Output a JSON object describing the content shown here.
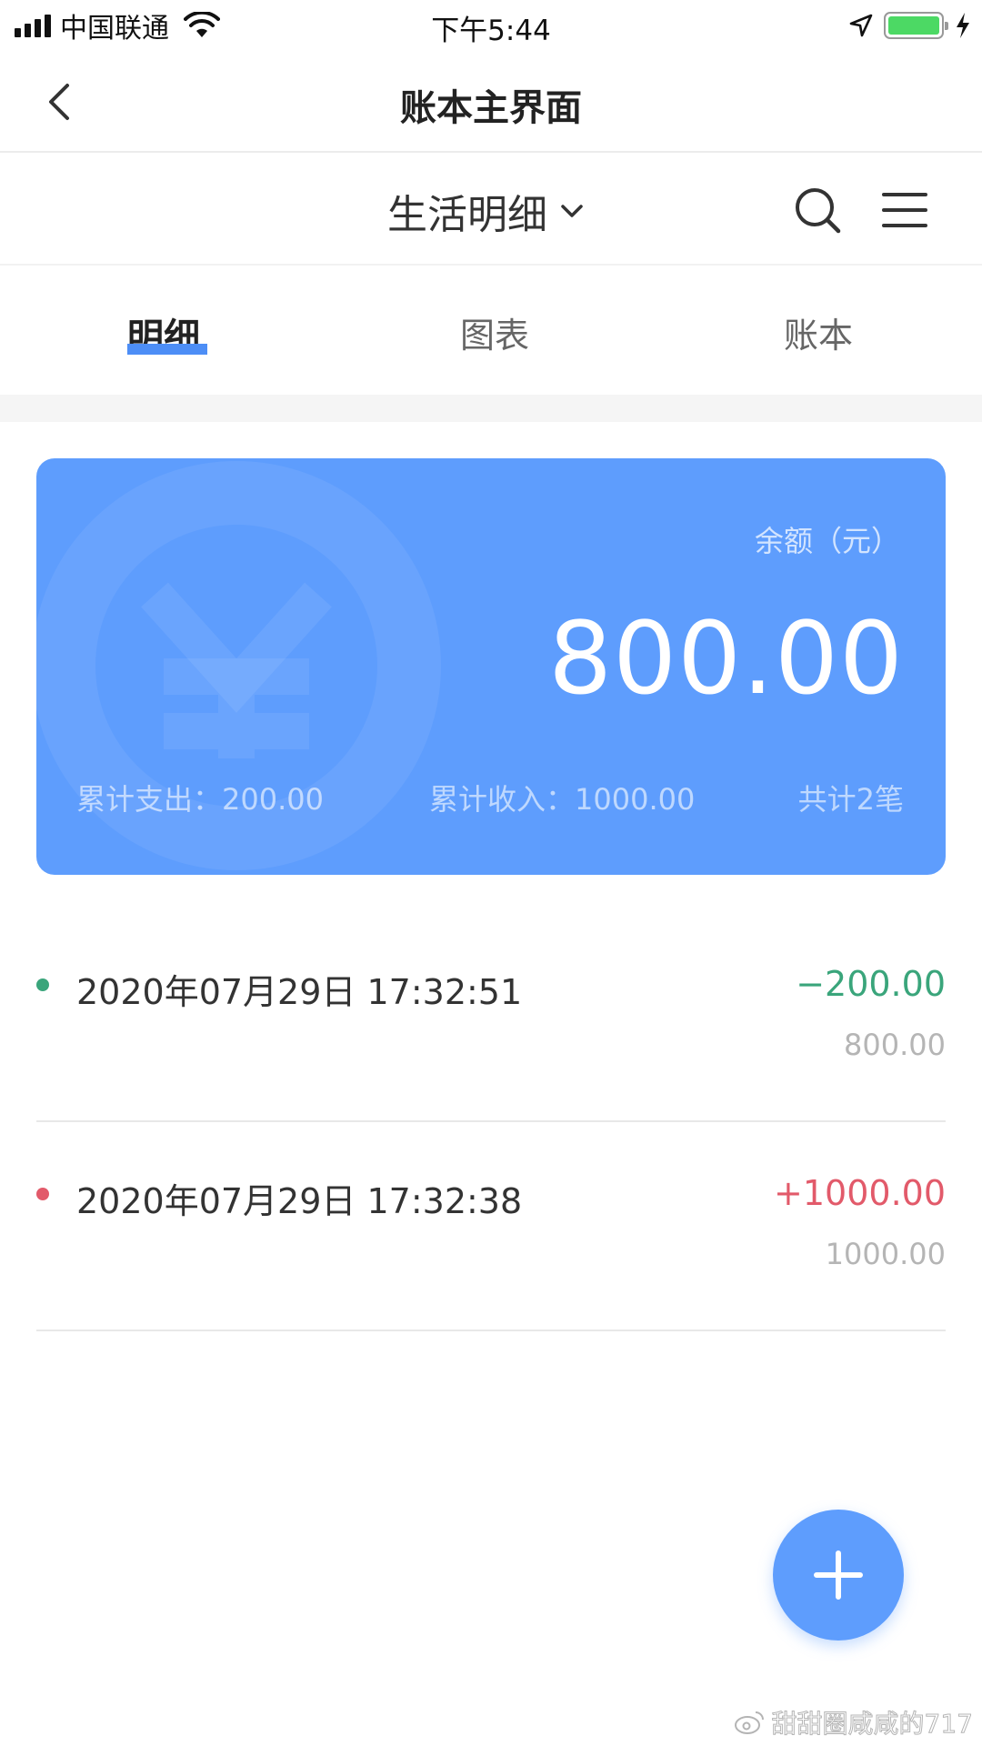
{
  "status_bar": {
    "carrier": "中国联通",
    "time": "下午5:44",
    "battery_level": 1.0,
    "battery_color": "#4cd964"
  },
  "nav": {
    "title": "账本主界面",
    "back_icon": "chevron-left-icon"
  },
  "book": {
    "name": "生活明细",
    "dropdown_icon": "chevron-down-icon",
    "search_icon": "search-icon",
    "menu_icon": "hamburger-menu-icon"
  },
  "tabs": [
    {
      "label": "明细",
      "active": true
    },
    {
      "label": "图表",
      "active": false
    },
    {
      "label": "账本",
      "active": false
    }
  ],
  "card": {
    "balance_label": "余额（元）",
    "balance": "800.00",
    "expense": "累计支出：200.00",
    "income": "累计收入：1000.00",
    "count": "共计2笔",
    "background_color": "#5e9dfd",
    "background_icon": "yuan-icon"
  },
  "records": [
    {
      "time": "2020年07月29日 17:32:51",
      "amount": "−200.00",
      "balance": "800.00",
      "color": "#3aa57b"
    },
    {
      "time": "2020年07月29日 17:32:38",
      "amount": "+1000.00",
      "balance": "1000.00",
      "color": "#e25a6a"
    }
  ],
  "fab": {
    "icon": "plus-icon"
  },
  "watermark": {
    "text": "甜甜圈咸咸的717",
    "icon": "weibo-icon"
  },
  "colors": {
    "accent": "#4d8ef6"
  }
}
